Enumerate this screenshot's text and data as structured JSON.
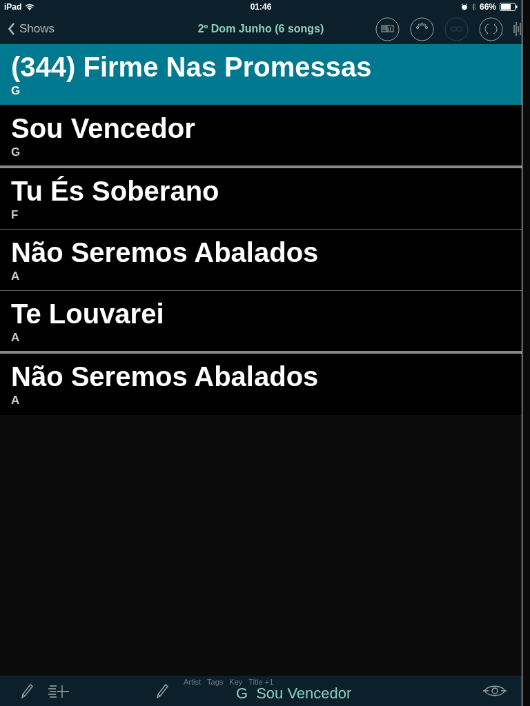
{
  "status_bar": {
    "device": "iPad",
    "time": "01:46",
    "battery": "66%"
  },
  "nav": {
    "back": "Shows",
    "title": "2º Dom Junho (6 songs)",
    "buttons": [
      {
        "kind": "layout",
        "disabled": false
      },
      {
        "kind": "midi",
        "disabled": false
      },
      {
        "kind": "link",
        "disabled": true
      },
      {
        "kind": "sync",
        "disabled": false
      },
      {
        "kind": "wave",
        "disabled": false
      }
    ]
  },
  "songs": [
    {
      "title": "(344) Firme Nas Promessas",
      "key": "G",
      "selected": true,
      "section_end": false
    },
    {
      "title": "Sou Vencedor",
      "key": "G",
      "selected": false,
      "section_end": true
    },
    {
      "title": "Tu És Soberano",
      "key": "F",
      "selected": false,
      "section_end": false
    },
    {
      "title": "Não Seremos Abalados",
      "key": "A",
      "selected": false,
      "section_end": false
    },
    {
      "title": "Te Louvarei",
      "key": "A",
      "selected": false,
      "section_end": true
    },
    {
      "title": "Não Seremos Abalados",
      "key": "A",
      "selected": false,
      "section_end": false
    }
  ],
  "toolbar": {
    "sort_labels": [
      "Artist",
      "Tags",
      "Key",
      "Title +1"
    ],
    "current_key": "G",
    "current_title": "Sou Vencedor"
  }
}
